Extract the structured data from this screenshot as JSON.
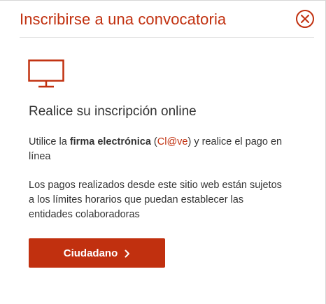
{
  "dialog": {
    "title": "Inscribirse a una convocatoria",
    "close_icon": "close-icon",
    "accent_color": "#c1300f"
  },
  "content": {
    "icon": "monitor-icon",
    "subtitle": "Realice su inscripción online",
    "para1": {
      "before": "Utilice la ",
      "bold": "firma electrónica",
      "middle": " (",
      "link": "Cl@ve",
      "after": ") y realice el pago en línea"
    },
    "para2": "Los pagos realizados desde este sitio web están sujetos a los límites horarios que puedan establecer las entidades colaboradoras"
  },
  "cta": {
    "label": "Ciudadano",
    "icon": "chevron-right-icon"
  }
}
